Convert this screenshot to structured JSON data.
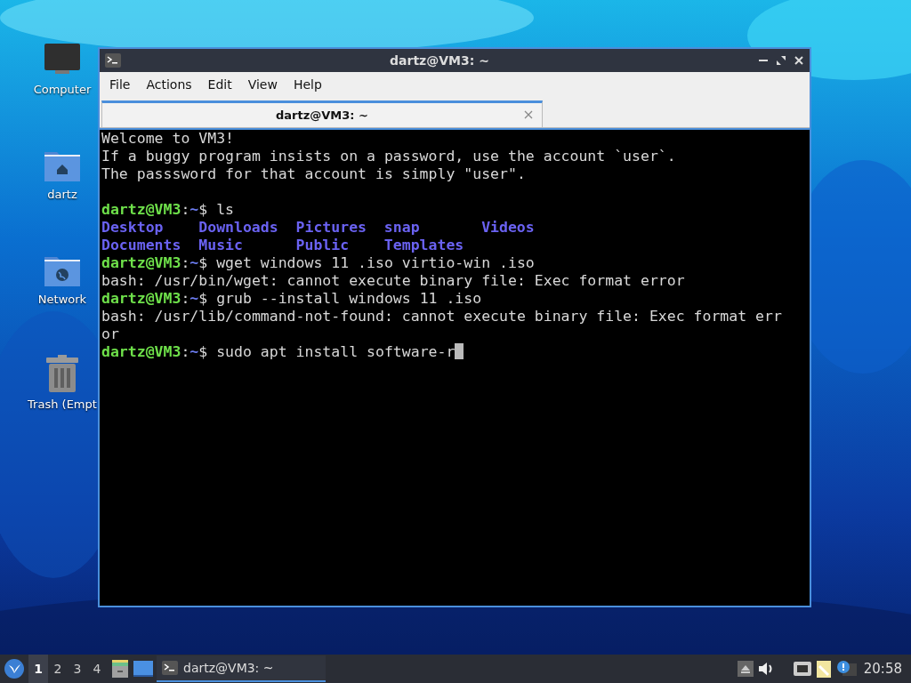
{
  "desktop_icons": [
    {
      "kind": "computer",
      "label": "Computer"
    },
    {
      "kind": "home",
      "label": "dartz"
    },
    {
      "kind": "network",
      "label": "Network"
    },
    {
      "kind": "trash",
      "label": "Trash (Empt"
    }
  ],
  "window": {
    "title": "dartz@VM3: ~",
    "focused": true
  },
  "menu": [
    "File",
    "Actions",
    "Edit",
    "View",
    "Help"
  ],
  "tabs": [
    {
      "label": "dartz@VM3: ~",
      "selected": true
    }
  ],
  "terminal": {
    "lines": [
      {
        "kind": "text",
        "text": "Welcome to VM3!"
      },
      {
        "kind": "text",
        "text": "If a buggy program insists on a password, use the account `user`."
      },
      {
        "kind": "text",
        "text": "The passsword for that account is simply \"user\"."
      },
      {
        "kind": "blank"
      },
      {
        "kind": "prompt",
        "user": "dartz@VM3",
        "colon": ":",
        "path": "~",
        "command": "$ ls",
        "cursor": false
      },
      {
        "kind": "listing",
        "items": [
          "Desktop",
          "Downloads",
          "Pictures",
          "snap",
          "Videos"
        ]
      },
      {
        "kind": "listing",
        "items": [
          "Documents",
          "Music",
          "Public",
          "Templates"
        ]
      },
      {
        "kind": "prompt",
        "user": "dartz@VM3",
        "colon": ":",
        "path": "~",
        "command": "$ wget windows 11 .iso virtio-win .iso",
        "cursor": false
      },
      {
        "kind": "text",
        "text": "bash: /usr/bin/wget: cannot execute binary file: Exec format error"
      },
      {
        "kind": "prompt",
        "user": "dartz@VM3",
        "colon": ":",
        "path": "~",
        "command": "$ grub --install windows 11 .iso",
        "cursor": false
      },
      {
        "kind": "text",
        "text": "bash: /usr/lib/command-not-found: cannot execute binary file: Exec format err"
      },
      {
        "kind": "text",
        "text": "or"
      },
      {
        "kind": "prompt",
        "user": "dartz@VM3",
        "colon": ":",
        "path": "~",
        "command": "$ sudo apt install software-r",
        "cursor": true
      }
    ]
  },
  "taskbar": {
    "workspaces": [
      {
        "label": "1",
        "selected": true
      },
      {
        "label": "2",
        "selected": false
      },
      {
        "label": "3",
        "selected": false
      },
      {
        "label": "4",
        "selected": false
      }
    ],
    "tasks": [
      {
        "label": "dartz@VM3: ~",
        "selected": true
      }
    ],
    "clock": "20:58"
  }
}
